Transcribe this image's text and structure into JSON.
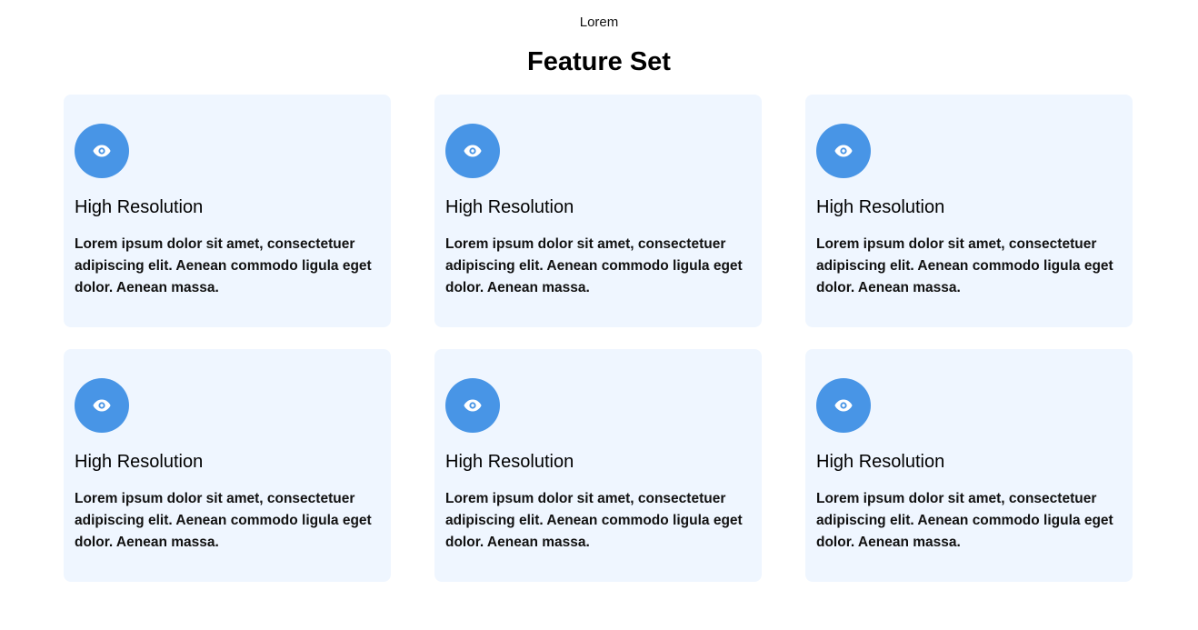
{
  "header": {
    "eyebrow": "Lorem",
    "title": "Feature Set"
  },
  "colors": {
    "card_background": "#eff6ff",
    "icon_background": "#4895e6",
    "icon_foreground": "#ffffff"
  },
  "features": [
    {
      "icon": "eye-icon",
      "title": "High Resolution",
      "description": "Lorem ipsum dolor sit amet, consectetuer adipiscing elit. Aenean commodo ligula eget dolor. Aenean massa."
    },
    {
      "icon": "eye-icon",
      "title": "High Resolution",
      "description": "Lorem ipsum dolor sit amet, consectetuer adipiscing elit. Aenean commodo ligula eget dolor. Aenean massa."
    },
    {
      "icon": "eye-icon",
      "title": "High Resolution",
      "description": "Lorem ipsum dolor sit amet, consectetuer adipiscing elit. Aenean commodo ligula eget dolor. Aenean massa."
    },
    {
      "icon": "eye-icon",
      "title": "High Resolution",
      "description": "Lorem ipsum dolor sit amet, consectetuer adipiscing elit. Aenean commodo ligula eget dolor. Aenean massa."
    },
    {
      "icon": "eye-icon",
      "title": "High Resolution",
      "description": "Lorem ipsum dolor sit amet, consectetuer adipiscing elit. Aenean commodo ligula eget dolor. Aenean massa."
    },
    {
      "icon": "eye-icon",
      "title": "High Resolution",
      "description": "Lorem ipsum dolor sit amet, consectetuer adipiscing elit. Aenean commodo ligula eget dolor. Aenean massa."
    }
  ]
}
